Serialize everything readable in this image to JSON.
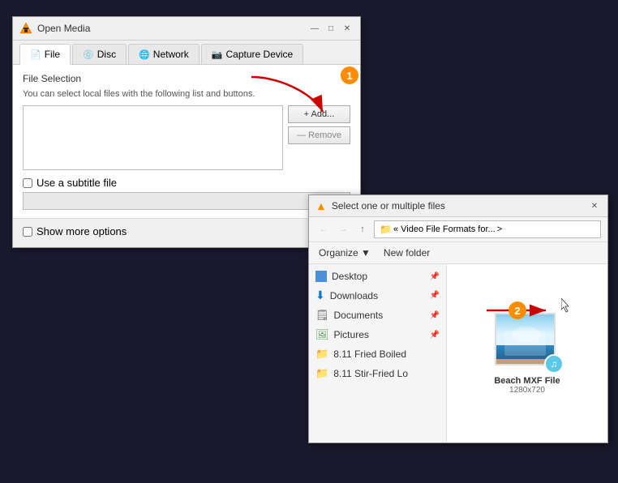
{
  "mainWindow": {
    "title": "Open Media",
    "tabs": [
      {
        "label": "File",
        "icon": "📄",
        "active": true
      },
      {
        "label": "Disc",
        "icon": "💿",
        "active": false
      },
      {
        "label": "Network",
        "icon": "🖧",
        "active": false
      },
      {
        "label": "Capture Device",
        "icon": "🎥",
        "active": false
      }
    ],
    "fileSelection": {
      "sectionLabel": "File Selection",
      "description": "You can select local files with the following list and buttons.",
      "addButton": "+ Add...",
      "removeButton": "— Remove"
    },
    "subtitleLabel": "Use a subtitle file",
    "showMoreOptions": "Show more options"
  },
  "browserWindow": {
    "title": "Select one or multiple files",
    "breadcrumb": "« Video File Formats for...",
    "organizeBtn": "Organize ▼",
    "newFolderBtn": "New folder",
    "treeItems": [
      {
        "label": "Desktop",
        "type": "desktop",
        "pinned": true
      },
      {
        "label": "Downloads",
        "type": "downloads",
        "pinned": true
      },
      {
        "label": "Documents",
        "type": "documents",
        "pinned": true
      },
      {
        "label": "Pictures",
        "type": "pictures",
        "pinned": true
      },
      {
        "label": "8.11 Fried Boiled",
        "type": "folder",
        "pinned": false
      },
      {
        "label": "8.11 Stir-Fried Lo",
        "type": "folder",
        "pinned": false
      }
    ],
    "previewFile": {
      "name": "Beach MXF File",
      "dimensions": "1280x720"
    }
  },
  "badges": {
    "one": "1",
    "two": "2"
  }
}
